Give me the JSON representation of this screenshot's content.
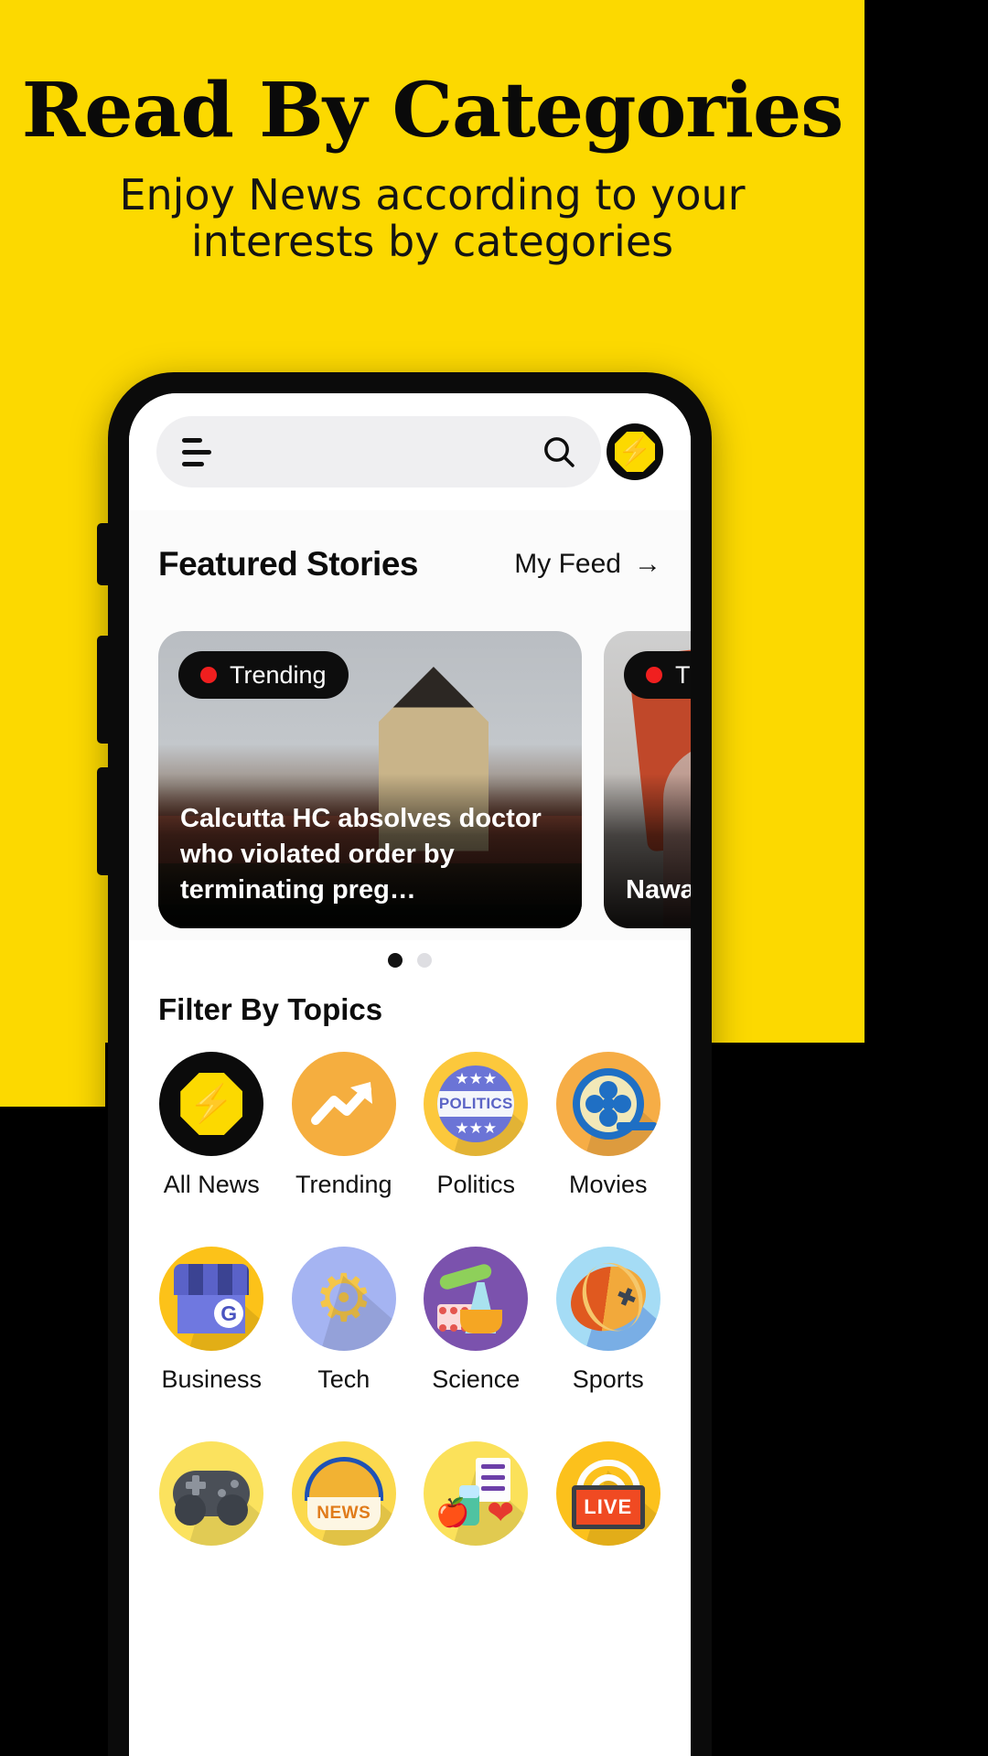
{
  "promo": {
    "title": "Read By Categories",
    "subtitle": "Enjoy News according to your interests by categories",
    "bg_color": "#FCD900"
  },
  "app": {
    "header": {
      "menu_icon": "hamburger-menu-icon",
      "search_icon": "search-icon",
      "logo_icon": "lightning-bolt-logo",
      "search_placeholder": ""
    },
    "featured": {
      "section_title": "Featured Stories",
      "my_feed_label": "My Feed",
      "my_feed_arrow": "→",
      "cards": [
        {
          "badge": "Trending",
          "badge_dot_color": "#f01f1f",
          "title": "Calcutta HC absolves doctor who violated order by terminating preg…"
        },
        {
          "badge": "Tre",
          "badge_dot_color": "#f01f1f",
          "title": "Nawaz improv"
        }
      ],
      "pagination": {
        "total": 2,
        "active": 0
      }
    },
    "topics": {
      "section_title": "Filter By Topics",
      "items": [
        {
          "label": "All News",
          "icon": "lightning-bolt-icon",
          "bg": "#0b0b0b"
        },
        {
          "label": "Trending",
          "icon": "trend-arrow-up-icon",
          "bg": "#f5ae3f"
        },
        {
          "label": "Politics",
          "icon": "politics-badge-icon",
          "bg": "#fcc83c"
        },
        {
          "label": "Movies",
          "icon": "film-reel-icon",
          "bg": "#f6ad46"
        },
        {
          "label": "Business",
          "icon": "storefront-icon",
          "bg": "#fcc219"
        },
        {
          "label": "Tech",
          "icon": "gear-circuit-icon",
          "bg": "#a5b4f2"
        },
        {
          "label": "Science",
          "icon": "lab-flask-icon",
          "bg": "#7b52ad"
        },
        {
          "label": "Sports",
          "icon": "sports-ball-icon",
          "bg": "#a5dcf5"
        },
        {
          "label": "",
          "icon": "game-controller-icon",
          "bg": "#fbe25e"
        },
        {
          "label": "",
          "icon": "news-globe-icon",
          "bg": "#fbd94e"
        },
        {
          "label": "",
          "icon": "health-icon",
          "bg": "#fbe15a"
        },
        {
          "label": "",
          "icon": "live-broadcast-icon",
          "bg": "#fcc11c"
        }
      ]
    }
  }
}
